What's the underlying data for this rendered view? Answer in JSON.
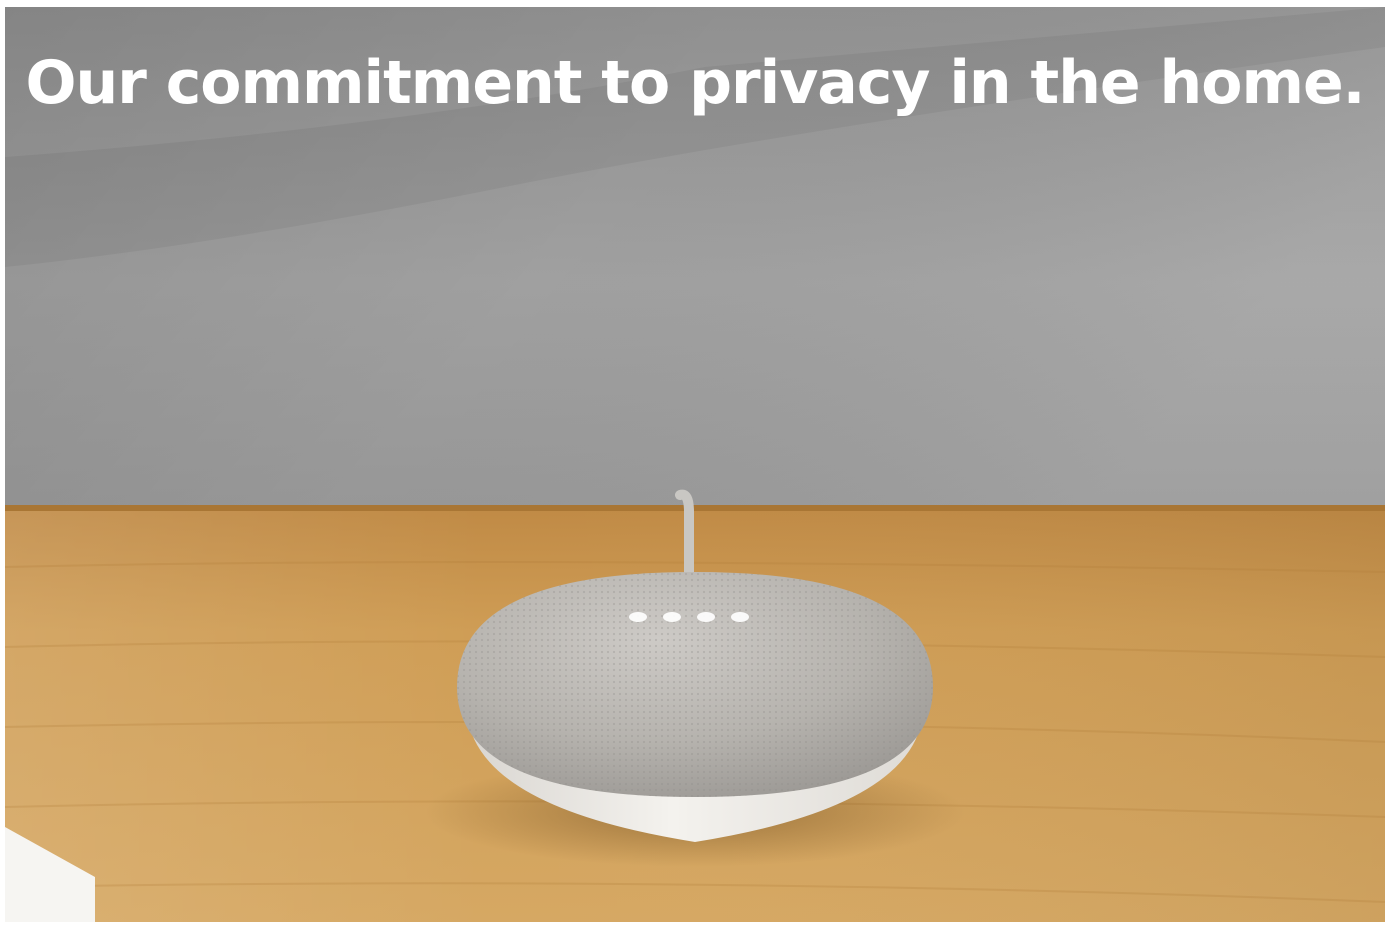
{
  "headline": {
    "text": "Our commitment to privacy in the home."
  },
  "scene": {
    "subject": "smart-speaker-icon",
    "colors": {
      "wall": "#8f8f8f",
      "table": "#c99a4f",
      "speaker_fabric": "#b9b6b1",
      "speaker_base": "#f2f0ec",
      "indicator_lights": "#ffffff",
      "headline_text": "#ffffff"
    },
    "indicator_light_count": 4
  }
}
